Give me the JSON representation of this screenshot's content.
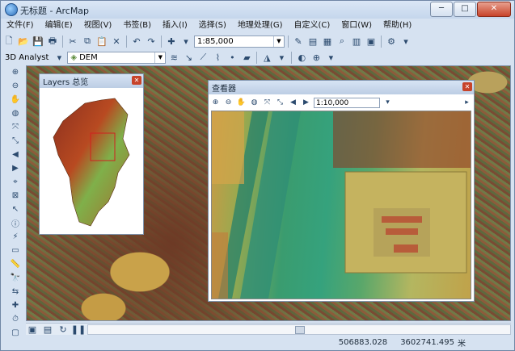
{
  "window": {
    "title": "无标题 - ArcMap",
    "minimize": "─",
    "maximize": "□",
    "close": "✕"
  },
  "menu": [
    "文件(F)",
    "编辑(E)",
    "视图(V)",
    "书签(B)",
    "插入(I)",
    "选择(S)",
    "地理处理(G)",
    "自定义(C)",
    "窗口(W)",
    "帮助(H)"
  ],
  "toolbar": {
    "scale": "1:85,000",
    "analyst_label": "3D Analyst",
    "layer": "DEM"
  },
  "overview_panel": {
    "title": "Layers 总览"
  },
  "viewer_panel": {
    "title": "查看器",
    "scale": "1:10,000"
  },
  "status": {
    "x": "506883.028",
    "y": "3602741.495",
    "unit": "米"
  },
  "icons": [
    "zoom-in-icon",
    "zoom-out-icon",
    "pan-icon",
    "globe-icon",
    "full-extent-icon",
    "back-icon",
    "forward-icon",
    "select-icon",
    "identify-icon",
    "find-icon",
    "measure-icon"
  ]
}
